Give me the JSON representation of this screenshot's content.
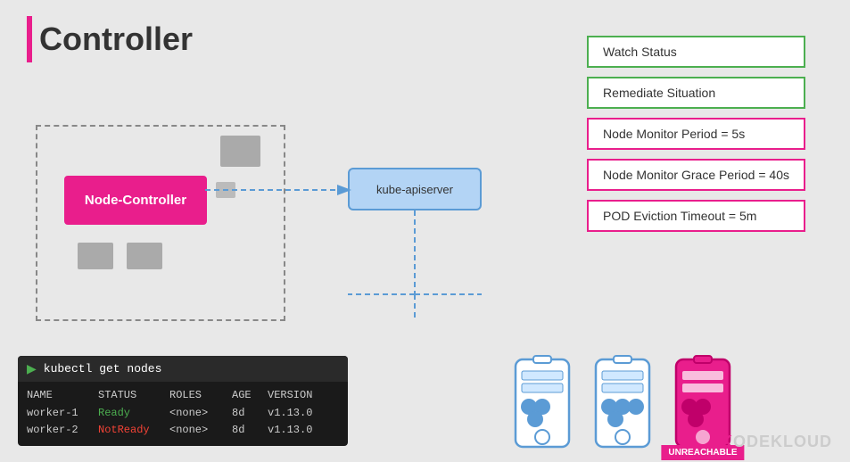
{
  "header": {
    "title": "Controller",
    "bar_color": "#e91e8c"
  },
  "status_panel": {
    "items": [
      {
        "label": "Watch Status",
        "border": "green"
      },
      {
        "label": "Remediate Situation",
        "border": "green"
      },
      {
        "label": "Node Monitor Period = 5s",
        "border": "pink"
      },
      {
        "label": "Node Monitor Grace Period = 40s",
        "border": "pink"
      },
      {
        "label": "POD Eviction Timeout = 5m",
        "border": "pink"
      }
    ]
  },
  "diagram": {
    "node_controller_label": "Node-Controller",
    "kube_apiserver_label": "kube-apiserver"
  },
  "terminal": {
    "command": "kubectl get nodes",
    "columns": [
      "NAME",
      "STATUS",
      "ROLES",
      "AGE",
      "VERSION"
    ],
    "rows": [
      {
        "name": "worker-1",
        "status": "Ready",
        "status_type": "ready",
        "roles": "<none>",
        "age": "8d",
        "version": "v1.13.0"
      },
      {
        "name": "worker-2",
        "status": "NotReady",
        "status_type": "not-ready",
        "roles": "<none>",
        "age": "8d",
        "version": "v1.13.0"
      }
    ]
  },
  "nodes": [
    {
      "id": "node1",
      "color": "blue",
      "unreachable": false
    },
    {
      "id": "node2",
      "color": "blue",
      "unreachable": false
    },
    {
      "id": "node3",
      "color": "pink",
      "unreachable": true
    }
  ],
  "unreachable_label": "UNREACHABLE",
  "watermark": "ODEKLOUD"
}
